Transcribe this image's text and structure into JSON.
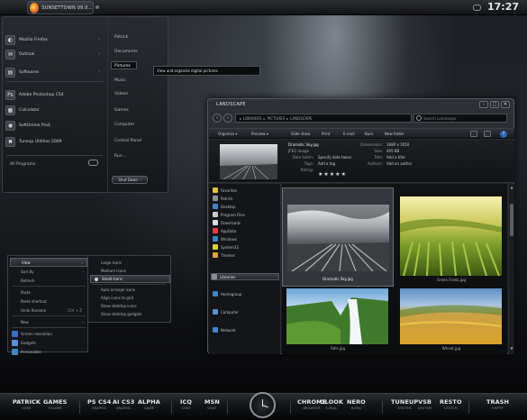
{
  "topbar": {
    "app_label": "SUNSETTOWN 09.0...",
    "clock": "17:27"
  },
  "startmenu": {
    "left_items": [
      {
        "label": "Mozilla Firefox",
        "icon": "firefox-icon",
        "glyph": "◐",
        "arrow": "›"
      },
      {
        "label": "Outlook",
        "icon": "mail-icon",
        "glyph": "✉",
        "arrow": "›"
      },
      {
        "label": "Softwares",
        "icon": "software-icon",
        "glyph": "▤",
        "arrow": "›"
      },
      {
        "label": "Adobe Photoshop CS4",
        "icon": "photoshop-icon",
        "glyph": "Ps",
        "arrow": ""
      },
      {
        "label": "Calculator",
        "icon": "calculator-icon",
        "glyph": "▦",
        "arrow": ""
      },
      {
        "label": "SoftOnline Pro4",
        "icon": "globe-icon",
        "glyph": "◉",
        "arrow": ""
      },
      {
        "label": "Tuneup Utilities 2009",
        "icon": "tools-icon",
        "glyph": "✖",
        "arrow": ""
      }
    ],
    "all_programs": "All Programs",
    "right_links": [
      "Patrick",
      "Documents",
      "Pictures",
      "Music",
      "Videos",
      "Games",
      "Computer",
      "Control Panel",
      "Run..."
    ],
    "active_link": "Pictures",
    "shutdown": "Shut Down",
    "tooltip": "View and organize digital pictures"
  },
  "context_menu": {
    "items": [
      {
        "label": "View",
        "arrow": "›",
        "highlight": true
      },
      {
        "label": "Sort By",
        "arrow": "›"
      },
      {
        "label": "Refresh"
      },
      {
        "label": "Paste",
        "sep_before": true
      },
      {
        "label": "Paste shortcut"
      },
      {
        "label": "Undo Rename",
        "shortcut": "Ctrl + Z"
      },
      {
        "label": "New",
        "arrow": "›",
        "sep_before": true
      },
      {
        "label": "Screen resolution",
        "sep_before": true,
        "icon_color": "#3a6fc2"
      },
      {
        "label": "Gadgets",
        "icon_color": "#5a8fd8"
      },
      {
        "label": "Personalize",
        "icon_color": "#3f86c7"
      }
    ],
    "submenu": [
      {
        "label": "Large Icons"
      },
      {
        "label": "Medium Icons"
      },
      {
        "label": "Small Icons",
        "selected": true
      },
      {
        "label": "Auto arrange icons",
        "sep_before": true
      },
      {
        "label": "Align icons to grid"
      },
      {
        "label": "Show desktop icons"
      },
      {
        "label": "Show desktop gadgets"
      }
    ]
  },
  "explorer": {
    "title": "LANDSCAPE",
    "window_controls": [
      "–",
      "□",
      "✕"
    ],
    "nav_back": "‹",
    "nav_forward": "›",
    "address": [
      "LIBRARIES",
      "PICTURES",
      "LANDSCAPE"
    ],
    "search_placeholder": "Search Landscape",
    "toolbar": [
      "Organize ▾",
      "Preview ▾",
      "Slide show",
      "Print",
      "E-mail",
      "Burn",
      "New folder"
    ],
    "details": {
      "labels_left": [
        "Dramatic Sky.jpg",
        "JPEG image",
        "Date taken:",
        "Tags:",
        "Rating:"
      ],
      "values_left": [
        "",
        "",
        "Specify date taken",
        "Add a tag",
        ""
      ],
      "labels_right": [
        "Dimensions:",
        "Size:",
        "Title:",
        "Authors:"
      ],
      "values_right": [
        "1680 x 1050",
        "405 KB",
        "Add a title",
        "Add an author"
      ],
      "rating": 5
    },
    "nav_pane": {
      "favorites_title": "Favorites",
      "favorites": [
        {
          "label": "Patrick",
          "color": "#8a8f96"
        },
        {
          "label": "Desktop",
          "color": "#3f86c7"
        },
        {
          "label": "Program Files",
          "color": "#c9cdd2"
        },
        {
          "label": "Downloads",
          "color": "#d8dce0"
        },
        {
          "label": "AppData",
          "color": "#e04040"
        },
        {
          "label": "Windows",
          "color": "#3f86c7"
        },
        {
          "label": "System32",
          "color": "#e0d040"
        },
        {
          "label": "Themes",
          "color": "#e0a040"
        }
      ],
      "libraries": "Libraries",
      "homegroup": "Homegroup",
      "computer": "Computer",
      "network": "Network"
    },
    "thumbnails": [
      {
        "caption": "Dramatic Sky.jpg",
        "selected": true
      },
      {
        "caption": "Green Fields.jpg",
        "selected": false
      },
      {
        "caption": "Falls.jpg",
        "selected": false
      },
      {
        "caption": "Wheat.jpg",
        "selected": false
      }
    ],
    "scroll_up": "▲",
    "scroll_down": "▼"
  },
  "dock": {
    "items": [
      {
        "label": "PATRICK",
        "sub": "USER"
      },
      {
        "label": "GAMES",
        "sub": "FOLDER"
      },
      {
        "label": "PS CS4",
        "sub": "GRAPHIC"
      },
      {
        "label": "AI CS3",
        "sub": "GRAPHIC"
      },
      {
        "label": "ALPHA",
        "sub": "GAME"
      },
      {
        "label": "ICQ",
        "sub": "CHAT"
      },
      {
        "label": "MSN",
        "sub": "CHAT"
      },
      {
        "label": "CHROME",
        "sub": "BROWSER"
      },
      {
        "label": "OLOOK",
        "sub": "E-MAIL"
      },
      {
        "label": "NERO",
        "sub": "BURN"
      },
      {
        "label": "TUNEUP",
        "sub": "SYSTEM"
      },
      {
        "label": "VSB",
        "sub": "SYSTEM"
      },
      {
        "label": "RESTO",
        "sub": "SYSTEM"
      },
      {
        "label": "TRASH",
        "sub": "EMPTY"
      }
    ]
  }
}
